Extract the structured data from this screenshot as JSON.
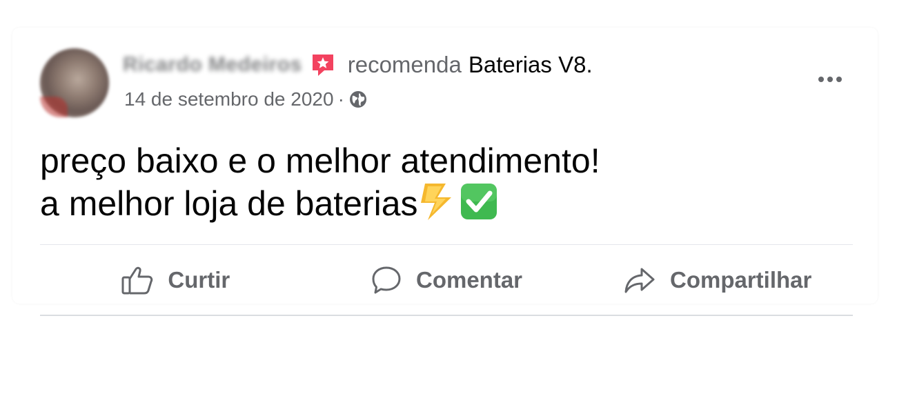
{
  "post": {
    "author_name": "Ricardo Medeiros",
    "recommend_word": "recomenda",
    "page_name": "Baterias V8",
    "page_name_suffix": ".",
    "date": "14 de setembro de 2020",
    "meta_separator": "·",
    "privacy_icon": "globe-icon",
    "more_icon": "more-options-icon",
    "body_line1": "preço baixo e o melhor atendimento!",
    "body_line2": "a melhor loja de baterias",
    "body_emojis": [
      "⚡",
      "✅"
    ]
  },
  "actions": {
    "like_label": "Curtir",
    "comment_label": "Comentar",
    "share_label": "Compartilhar"
  },
  "colors": {
    "recommend_badge": "#f3425f",
    "secondary_text": "#65676b",
    "primary_text": "#050505",
    "check_green": "#3fb950",
    "lightning_yellow": "#f5b82e"
  }
}
